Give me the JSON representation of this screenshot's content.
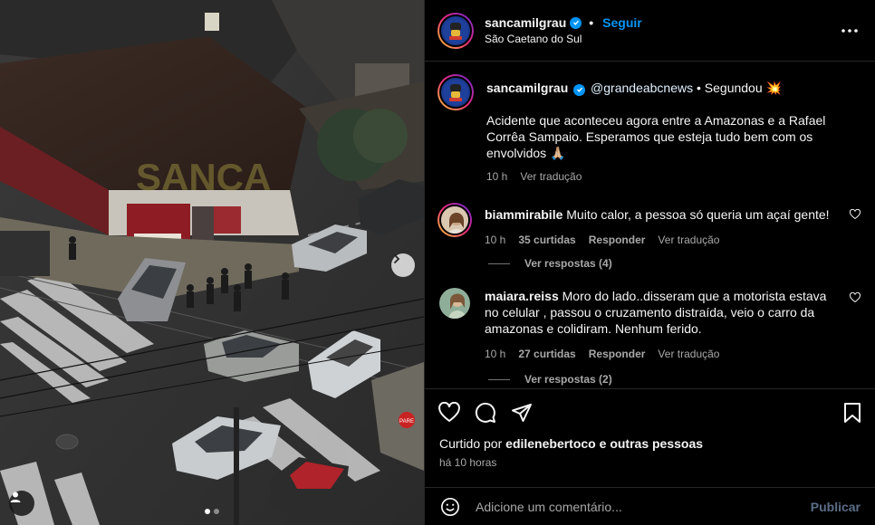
{
  "post": {
    "author": "sancamilgrau",
    "follow_label": "Seguir",
    "separator": "•",
    "location": "São Caetano do Sul",
    "more_icon": "more-horizontal-icon"
  },
  "caption": {
    "author": "sancamilgrau",
    "mention": "@grandeabcnews",
    "suffix": "• Segundou 💥",
    "text": "Acidente que aconteceu agora entre a Amazonas e a Rafael Corrêa Sampaio. Esperamos que esteja tudo bem com os envolvidos 🙏🏼",
    "time": "10 h",
    "translate": "Ver tradução"
  },
  "comments": [
    {
      "user": "biammirabile",
      "text": "Muito calor, a pessoa só queria um açaí gente!",
      "time": "10 h",
      "likes": "35 curtidas",
      "reply": "Responder",
      "translate": "Ver tradução",
      "view_replies": "Ver respostas (4)"
    },
    {
      "user": "maiara.reiss",
      "text": "Moro do lado..disseram que a motorista estava no celular , passou o cruzamento distraída, veio o carro da amazonas e colidiram. Nenhum ferido.",
      "time": "10 h",
      "likes": "27 curtidas",
      "reply": "Responder",
      "translate": "Ver tradução",
      "view_replies": "Ver respostas (2)"
    }
  ],
  "likes": {
    "prefix": "Curtido por",
    "user": "edilenebertoco",
    "suffix": "e outras pessoas"
  },
  "posted_ago": "há 10 horas",
  "composer": {
    "placeholder": "Adicione um comentário...",
    "publish_label": "Publicar"
  },
  "photo": {
    "watermark": "SANCA",
    "stop_sign": "PARE",
    "carousel_count": 2,
    "carousel_active": 1
  },
  "colors": {
    "accent": "#0095f6",
    "background": "#000000",
    "muted_text": "#a8a8a8"
  }
}
